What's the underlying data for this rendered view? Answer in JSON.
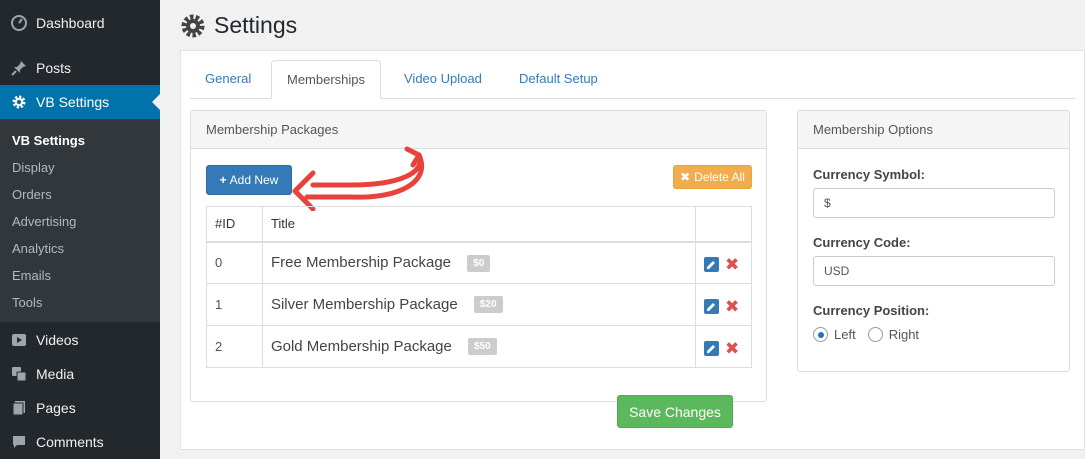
{
  "sidebar": {
    "top_items": [
      {
        "label": "Dashboard",
        "icon": "dashboard-icon"
      },
      {
        "label": "Posts",
        "icon": "pin-icon"
      },
      {
        "label": "VB Settings",
        "icon": "gear-icon"
      }
    ],
    "submenu": [
      "VB Settings",
      "Display",
      "Orders",
      "Advertising",
      "Analytics",
      "Emails",
      "Tools"
    ],
    "bottom_items": [
      {
        "label": "Videos",
        "icon": "play-icon"
      },
      {
        "label": "Media",
        "icon": "media-icon"
      },
      {
        "label": "Pages",
        "icon": "pages-icon"
      },
      {
        "label": "Comments",
        "icon": "comment-icon"
      }
    ]
  },
  "page": {
    "title": "Settings"
  },
  "tabs": [
    "General",
    "Memberships",
    "Video Upload",
    "Default Setup"
  ],
  "packages": {
    "heading": "Membership Packages",
    "add_label": "Add New",
    "delete_all_label": "Delete All",
    "columns": [
      "#ID",
      "Title"
    ],
    "rows": [
      {
        "id": "0",
        "title": "Free Membership Package",
        "price": "$0"
      },
      {
        "id": "1",
        "title": "Silver Membership Package",
        "price": "$20"
      },
      {
        "id": "2",
        "title": "Gold Membership Package",
        "price": "$50"
      }
    ]
  },
  "options": {
    "heading": "Membership Options",
    "currency_symbol_label": "Currency Symbol:",
    "currency_symbol_value": "$",
    "currency_code_label": "Currency Code:",
    "currency_code_value": "USD",
    "currency_position_label": "Currency Position:",
    "position_left": "Left",
    "position_right": "Right"
  },
  "save_label": "Save Changes",
  "colors": {
    "primary": "#337ab7",
    "warning": "#f0ad4e",
    "success": "#5cb85c",
    "danger": "#d9534f",
    "sidebar_bg": "#23282d",
    "sidebar_active": "#0073aa",
    "annotation_arrow": "#e8423a"
  }
}
